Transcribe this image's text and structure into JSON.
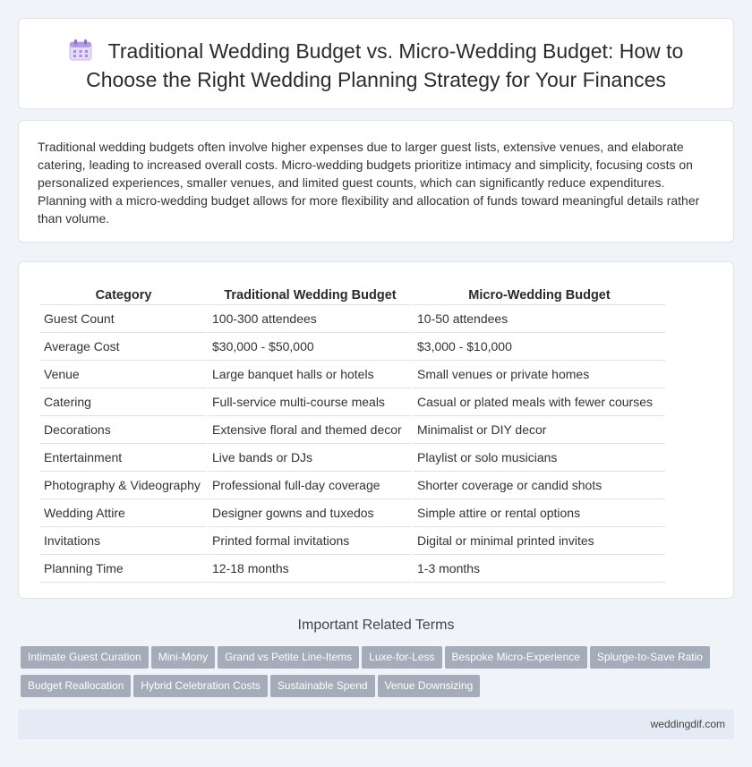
{
  "title": "Traditional Wedding Budget vs. Micro-Wedding Budget: How to Choose the Right Wedding Planning Strategy for Your Finances",
  "title_icon": "calendar-icon",
  "intro": "Traditional wedding budgets often involve higher expenses due to larger guest lists, extensive venues, and elaborate catering, leading to increased overall costs. Micro-wedding budgets prioritize intimacy and simplicity, focusing costs on personalized experiences, smaller venues, and limited guest counts, which can significantly reduce expenditures. Planning with a micro-wedding budget allows for more flexibility and allocation of funds toward meaningful details rather than volume.",
  "table": {
    "headers": [
      "Category",
      "Traditional Wedding Budget",
      "Micro-Wedding Budget"
    ],
    "rows": [
      [
        "Guest Count",
        "100-300 attendees",
        "10-50 attendees"
      ],
      [
        "Average Cost",
        "$30,000 - $50,000",
        "$3,000 - $10,000"
      ],
      [
        "Venue",
        "Large banquet halls or hotels",
        "Small venues or private homes"
      ],
      [
        "Catering",
        "Full-service multi-course meals",
        "Casual or plated meals with fewer courses"
      ],
      [
        "Decorations",
        "Extensive floral and themed decor",
        "Minimalist or DIY decor"
      ],
      [
        "Entertainment",
        "Live bands or DJs",
        "Playlist or solo musicians"
      ],
      [
        "Photography & Videography",
        "Professional full-day coverage",
        "Shorter coverage or candid shots"
      ],
      [
        "Wedding Attire",
        "Designer gowns and tuxedos",
        "Simple attire or rental options"
      ],
      [
        "Invitations",
        "Printed formal invitations",
        "Digital or minimal printed invites"
      ],
      [
        "Planning Time",
        "12-18 months",
        "1-3 months"
      ]
    ]
  },
  "related": {
    "title": "Important Related Terms",
    "tags": [
      "Intimate Guest Curation",
      "Mini-Mony",
      "Grand vs Petite Line-Items",
      "Luxe-for-Less",
      "Bespoke Micro-Experience",
      "Splurge-to-Save Ratio",
      "Budget Reallocation",
      "Hybrid Celebration Costs",
      "Sustainable Spend",
      "Venue Downsizing"
    ]
  },
  "footer": "weddingdif.com",
  "colors": {
    "background": "#f0f3f8",
    "tag": "#a3acb8",
    "footer": "#e5ebf5"
  }
}
